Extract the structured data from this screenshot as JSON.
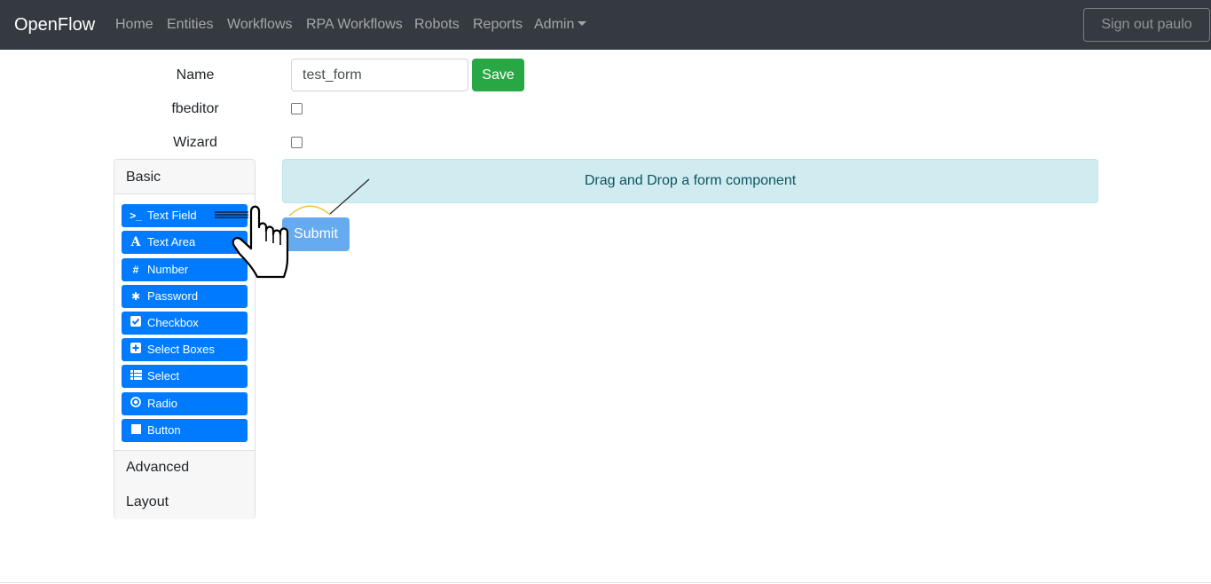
{
  "navbar": {
    "brand": "OpenFlow",
    "links": [
      "Home",
      "Entities",
      "Workflows",
      "RPA Workflows",
      "Robots",
      "Reports",
      "Admin"
    ],
    "signout_label": "Sign out paulo"
  },
  "form": {
    "name_label": "Name",
    "name_value": "test_form",
    "save_label": "Save",
    "fbeditor_label": "fbeditor",
    "fbeditor_checked": false,
    "wizard_label": "Wizard",
    "wizard_checked": false
  },
  "sidebar": {
    "groups": [
      "Basic",
      "Advanced",
      "Layout"
    ],
    "components": [
      {
        "label": "Text Field",
        "icon": "terminal-icon"
      },
      {
        "label": "Text Area",
        "icon": "font-icon"
      },
      {
        "label": "Number",
        "icon": "hashtag-icon"
      },
      {
        "label": "Password",
        "icon": "asterisk-icon"
      },
      {
        "label": "Checkbox",
        "icon": "check-square-icon"
      },
      {
        "label": "Select Boxes",
        "icon": "plus-square-icon"
      },
      {
        "label": "Select",
        "icon": "th-list-icon"
      },
      {
        "label": "Radio",
        "icon": "dot-circle-icon"
      },
      {
        "label": "Button",
        "icon": "stop-icon"
      }
    ]
  },
  "builder": {
    "dropzone_text": "Drag and Drop a form component",
    "submit_label": "Submit"
  },
  "colors": {
    "navbar_bg": "#343a40",
    "primary": "#007bff",
    "success": "#28a745",
    "info_bg": "#d1ecf1",
    "info_text": "#0c5460"
  }
}
